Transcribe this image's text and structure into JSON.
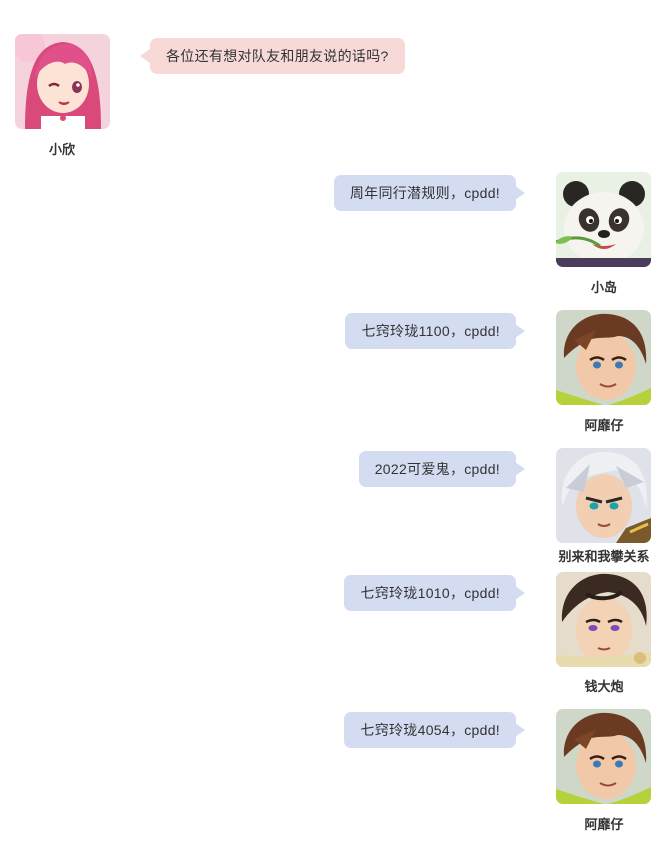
{
  "colors": {
    "left_bubble": "#f7dad8",
    "right_bubble": "#d3dcf1",
    "text": "#333333"
  },
  "messages": [
    {
      "side": "left",
      "name": "小欣",
      "text": "各位还有想对队友和朋友说的话吗?",
      "avatar_icon": "pink-hair-girl-avatar-icon"
    },
    {
      "side": "right",
      "name": "小岛",
      "text": "周年同行潜规则，cpdd!",
      "avatar_icon": "panda-avatar-icon"
    },
    {
      "side": "right",
      "name": "阿靡仔",
      "text": "七窍玲珑1100，cpdd!",
      "avatar_icon": "brown-hair-boy-avatar-icon"
    },
    {
      "side": "right",
      "name": "别来和我攀关系",
      "text": "2022可爱鬼，cpdd!",
      "avatar_icon": "white-hair-warrior-avatar-icon"
    },
    {
      "side": "right",
      "name": "钱大炮",
      "text": "七窍玲珑1010，cpdd!",
      "avatar_icon": "purple-eyed-youth-avatar-icon"
    },
    {
      "side": "right",
      "name": "阿靡仔",
      "text": "七窍玲珑4054，cpdd!",
      "avatar_icon": "brown-hair-boy-avatar-icon"
    }
  ]
}
